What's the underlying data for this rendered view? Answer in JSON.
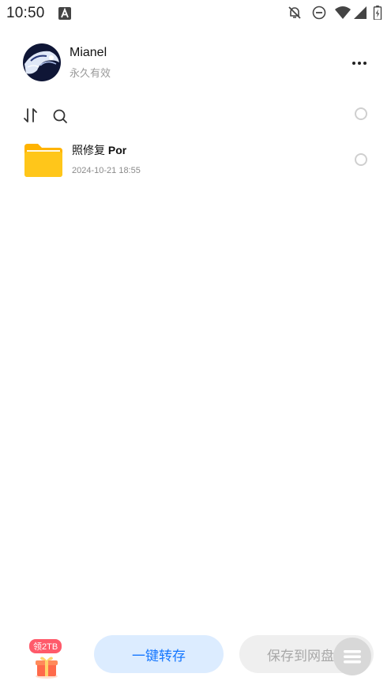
{
  "status_bar": {
    "time": "10:50",
    "icons": [
      "app-notification-icon",
      "notifications-off-icon",
      "do-not-disturb-icon",
      "wifi-icon",
      "cell-signal-icon",
      "battery-icon"
    ]
  },
  "header": {
    "name": "Mianel",
    "subtitle": "永久有效"
  },
  "files": [
    {
      "name_prefix": "照修复 ",
      "name_bold": "Por",
      "date": "2024-10-21 18:55",
      "icon": "folder-icon"
    }
  ],
  "bottom": {
    "gift_badge": "领2TB",
    "primary_label": "一键转存",
    "secondary_label": "保存到网盘"
  },
  "colors": {
    "accent": "#1677ff",
    "primary_bg": "#dcecff",
    "badge": "#ff5a6a",
    "folder": "#ffc61a"
  }
}
